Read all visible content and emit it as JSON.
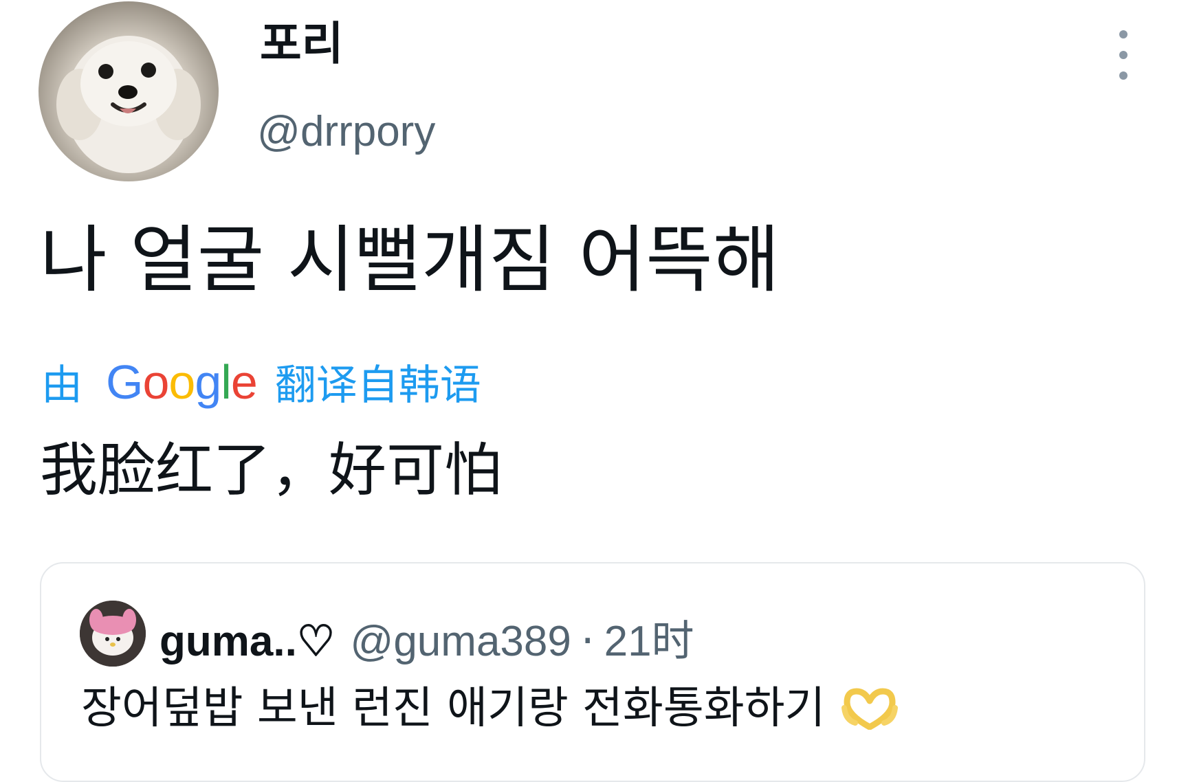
{
  "tweet": {
    "author": {
      "display_name": "포리",
      "handle": "@drrpory",
      "avatar_icon": "dog-avatar-icon"
    },
    "text": "나 얼굴 시뻘개짐 어뜩해",
    "translation": {
      "prefix": "由",
      "provider_logo": {
        "letters": [
          "G",
          "o",
          "o",
          "g",
          "l",
          "e"
        ],
        "colors": [
          "#4285f4",
          "#ea4335",
          "#fbbc05",
          "#4285f4",
          "#34a853",
          "#ea4335"
        ]
      },
      "suffix": "翻译自韩语",
      "text": "我脸红了，好可怕"
    },
    "more_icon": "more-vertical-icon",
    "quoted": {
      "display_name": "guma..♡",
      "handle": "@guma389",
      "separator": "·",
      "time": "21时",
      "text": "장어덮밥 보낸 런진 애기랑 전화통화하기",
      "emoji_icon": "heart-hands-icon"
    }
  },
  "colors": {
    "text_primary": "#0f1419",
    "text_secondary": "#536471",
    "link_blue": "#1d9bf0",
    "border": "#e5e8eb"
  }
}
